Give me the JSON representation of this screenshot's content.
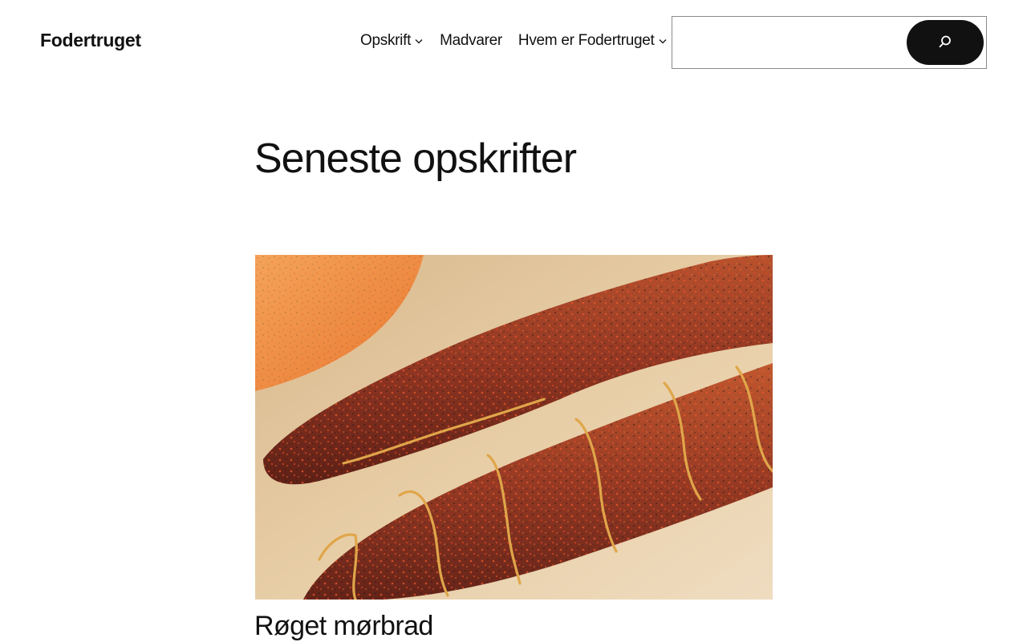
{
  "header": {
    "site_title": "Fodertruget",
    "nav": [
      {
        "label": "Opskrift",
        "has_submenu": true
      },
      {
        "label": "Madvarer",
        "has_submenu": false
      },
      {
        "label": "Hvem er Fodertruget",
        "has_submenu": true
      }
    ],
    "search": {
      "value": "",
      "placeholder": "",
      "button_icon": "search-icon"
    }
  },
  "main": {
    "page_title": "Seneste opskrifter",
    "posts": [
      {
        "title": "Røget mørbrad",
        "image_icon": "smoked-tenderloin-photo"
      }
    ]
  },
  "colors": {
    "text": "#111111",
    "background": "#ffffff",
    "button": "#111111",
    "border": "#8a8a8a"
  }
}
